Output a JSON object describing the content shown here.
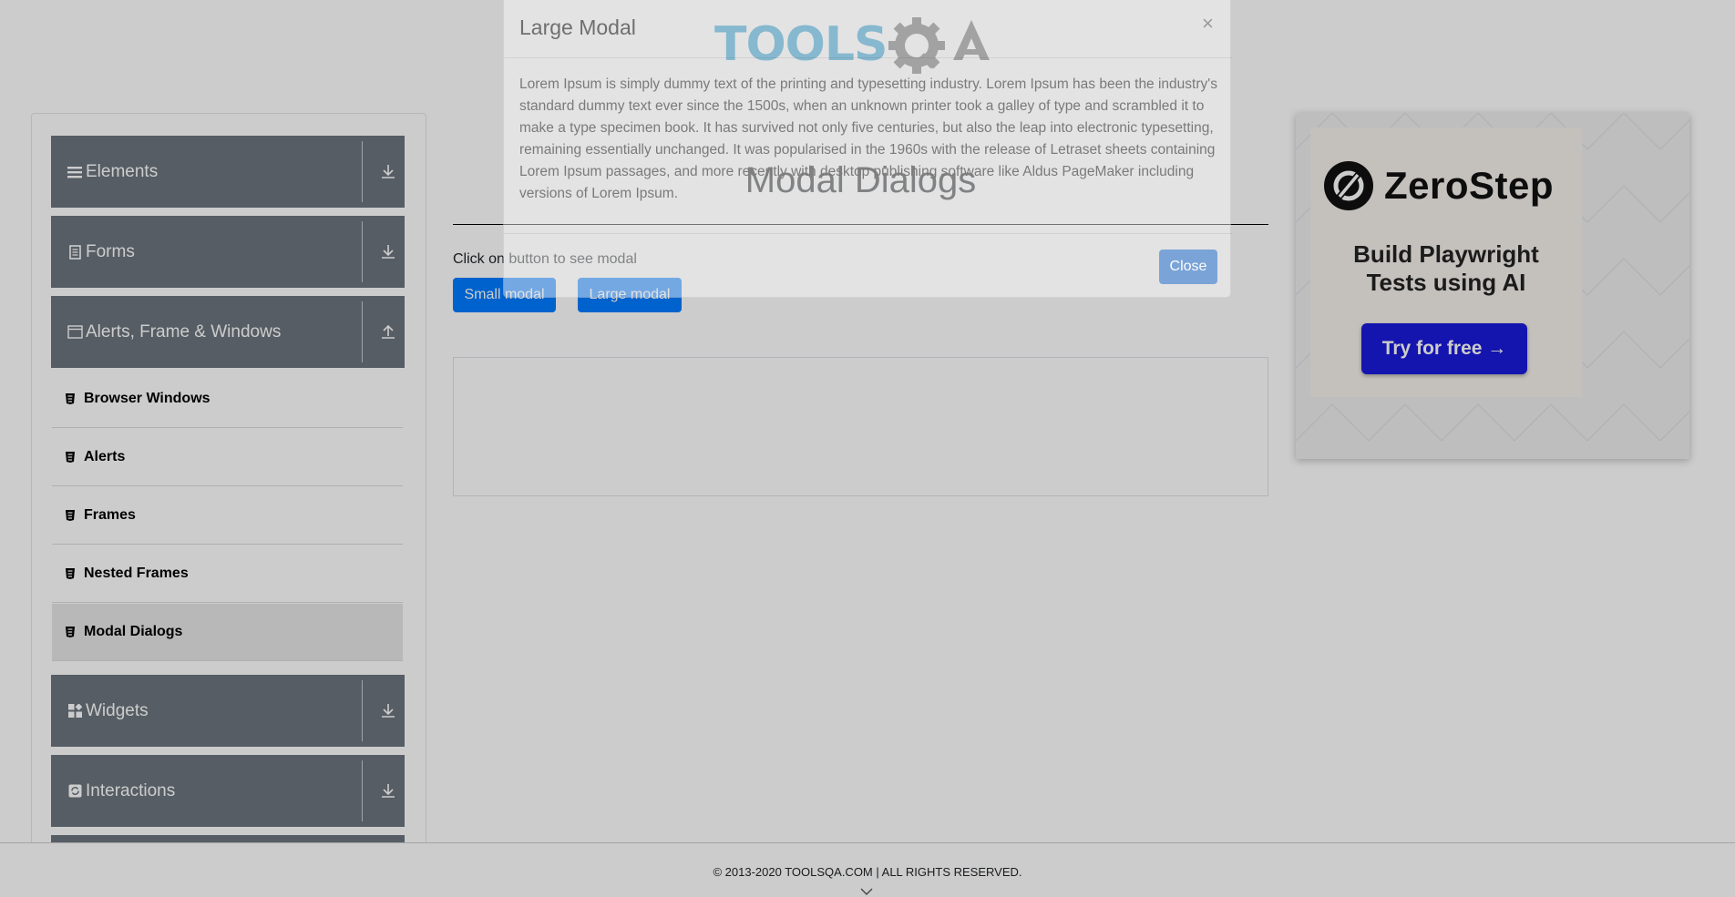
{
  "header": {
    "logo_text": "TOOLSQA"
  },
  "sidebar": {
    "groups": [
      {
        "label": "Elements",
        "icon": "list-icon",
        "expanded": false
      },
      {
        "label": "Forms",
        "icon": "document-icon",
        "expanded": false
      },
      {
        "label": "Alerts, Frame & Windows",
        "icon": "window-icon",
        "expanded": true
      },
      {
        "label": "Widgets",
        "icon": "widgets-icon",
        "expanded": false
      },
      {
        "label": "Interactions",
        "icon": "refresh-icon",
        "expanded": false
      }
    ],
    "items": [
      {
        "label": "Browser Windows",
        "active": false
      },
      {
        "label": "Alerts",
        "active": false
      },
      {
        "label": "Frames",
        "active": false
      },
      {
        "label": "Nested Frames",
        "active": false
      },
      {
        "label": "Modal Dialogs",
        "active": true
      }
    ]
  },
  "main": {
    "title": "Modal Dialogs",
    "instruction": "Click on button to see modal",
    "small_modal_label": "Small modal",
    "large_modal_label": "Large modal"
  },
  "modal": {
    "title": "Large Modal",
    "close_symbol": "×",
    "body": "Lorem Ipsum is simply dummy text of the printing and typesetting industry. Lorem Ipsum has been the industry's standard dummy text ever since the 1500s, when an unknown printer took a galley of type and scrambled it to make a type specimen book. It has survived not only five centuries, but also the leap into electronic typesetting, remaining essentially unchanged. It was popularised in the 1960s with the release of Letraset sheets containing Lorem Ipsum passages, and more recently with desktop publishing software like Aldus PageMaker including versions of Lorem Ipsum.",
    "close_label": "Close"
  },
  "ad": {
    "brand": "ZeroStep",
    "headline_line1": "Build Playwright",
    "headline_line2": "Tests using AI",
    "cta": "Try for free →"
  },
  "footer": {
    "text": "© 2013-2020 TOOLSQA.COM | ALL RIGHTS RESERVED."
  },
  "colors": {
    "nav_group_bg": "#6c757d",
    "primary_button": "#007bff",
    "ad_cta": "#1a1adb",
    "logo_blue": "#2e9fd3",
    "logo_gray": "#6d6d6d"
  }
}
